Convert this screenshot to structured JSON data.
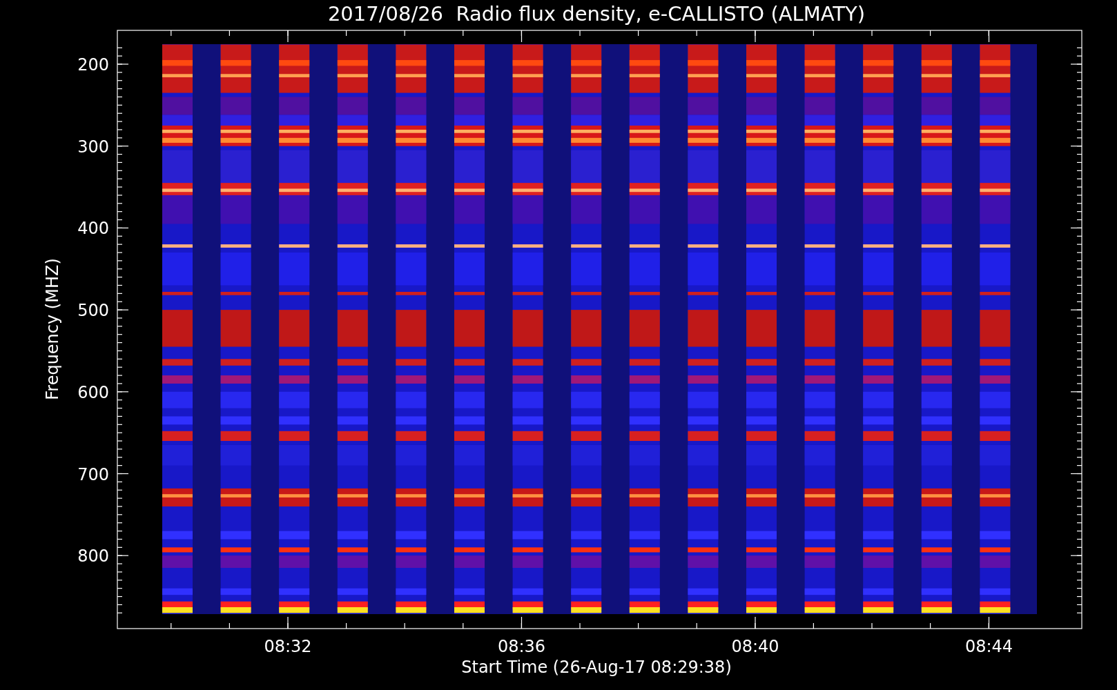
{
  "plot": {
    "title": "2017/08/26  Radio flux density, e-CALLISTO (ALMATY)",
    "ylabel": "Frequency (MHZ)",
    "xlabel": "Start Time (26-Aug-17 08:29:38)",
    "yticks": [
      "200",
      "300",
      "400",
      "500",
      "600",
      "700",
      "800"
    ],
    "xticks": [
      "08:32",
      "08:36",
      "08:40",
      "08:44"
    ]
  }
}
